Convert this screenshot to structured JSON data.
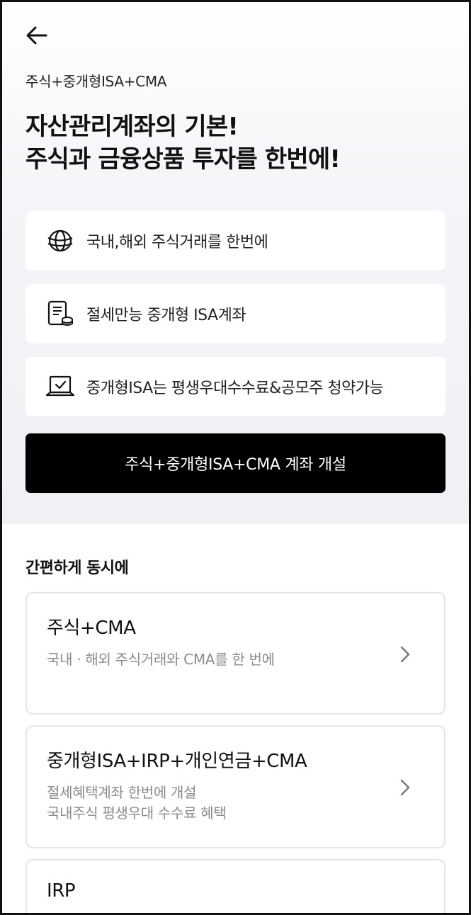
{
  "header": {
    "back_icon": "arrow-left-icon",
    "subtitle": "주식+중개형ISA+CMA",
    "headline_line1": "자산관리계좌의 기본!",
    "headline_line2": "주식과 금융상품 투자를 한번에!"
  },
  "features": [
    {
      "icon": "globe-icon",
      "text": "국내,해외 주식거래를 한번에"
    },
    {
      "icon": "document-coins-icon",
      "text": "절세만능 중개형 ISA계좌"
    },
    {
      "icon": "laptop-check-icon",
      "text": "중개형ISA는 평생우대수수료&공모주 청약가능"
    }
  ],
  "cta": {
    "label": "주식+중개형ISA+CMA 계좌 개설"
  },
  "section": {
    "title": "간편하게 동시에",
    "cards": [
      {
        "title": "주식+CMA",
        "desc": [
          "국내 · 해외 주식거래와 CMA를 한 번에"
        ]
      },
      {
        "title": "중개형ISA+IRP+개인연금+CMA",
        "desc": [
          "절세혜택계좌 한번에 개설",
          "국내주식 평생우대 수수료 혜택"
        ]
      },
      {
        "title": "IRP",
        "desc": []
      }
    ]
  },
  "colors": {
    "cta_bg": "#000000",
    "top_bg": "#eff1f5",
    "card_border": "#e5e6e9",
    "muted_text": "#8b8b8b"
  }
}
